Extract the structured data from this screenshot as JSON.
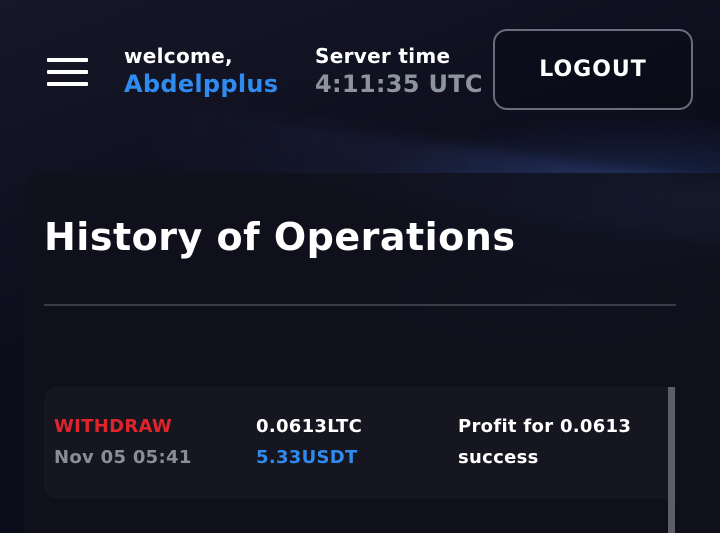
{
  "header": {
    "welcome_label": "welcome,",
    "username": "Abdelpplus",
    "server_time_label": "Server time",
    "server_time_value": "4:11:35 UTC",
    "logout_label": "LOGOUT"
  },
  "history": {
    "title": "History of Operations",
    "operations": [
      {
        "type": "WITHDRAW",
        "date": "Nov 05 05:41",
        "amount": "0.0613LTC",
        "usd_value": "5.33USDT",
        "description": "Profit for 0.0613",
        "status": "success"
      }
    ]
  },
  "colors": {
    "accent_blue": "#2f8bf0",
    "withdraw_red": "#e0242b",
    "muted_gray": "#8e93a0",
    "background": "#0c0d1a"
  },
  "icons": {
    "menu": "hamburger-menu-icon"
  }
}
